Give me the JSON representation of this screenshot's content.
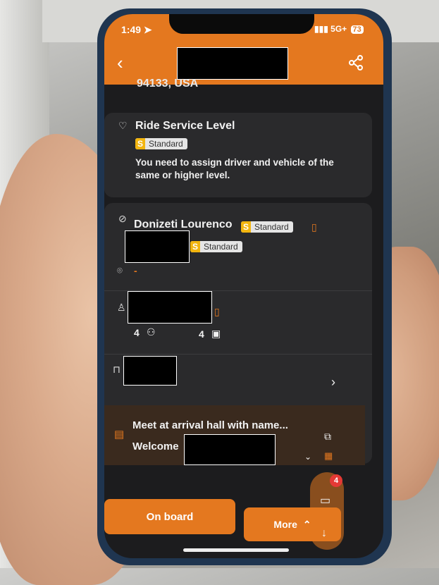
{
  "status_bar": {
    "time": "1:49",
    "network": "5G+",
    "battery": "73"
  },
  "header": {
    "title_redacted": true
  },
  "address_partial": "94133, USA",
  "ride_service": {
    "title": "Ride Service Level",
    "badge_letter": "S",
    "badge_label": "Standard",
    "note": "You need to assign driver and vehicle of the same or higher level."
  },
  "driver": {
    "name": "Donizeti Lourenco",
    "badge_letter": "S",
    "badge_label": "Standard",
    "vehicle_badge_letter": "S",
    "vehicle_badge_label": "Standard",
    "location_value": "-"
  },
  "passenger": {
    "passengers": "4",
    "luggage": "4"
  },
  "meet": {
    "line1": "Meet at arrival hall with name...",
    "line2_prefix": "Welcome"
  },
  "chat_badge_count": "4",
  "buttons": {
    "on_board": "On board",
    "more": "More"
  },
  "colors": {
    "accent": "#e4781f",
    "badge": "#f2b50f",
    "card": "#2a2a2c"
  }
}
